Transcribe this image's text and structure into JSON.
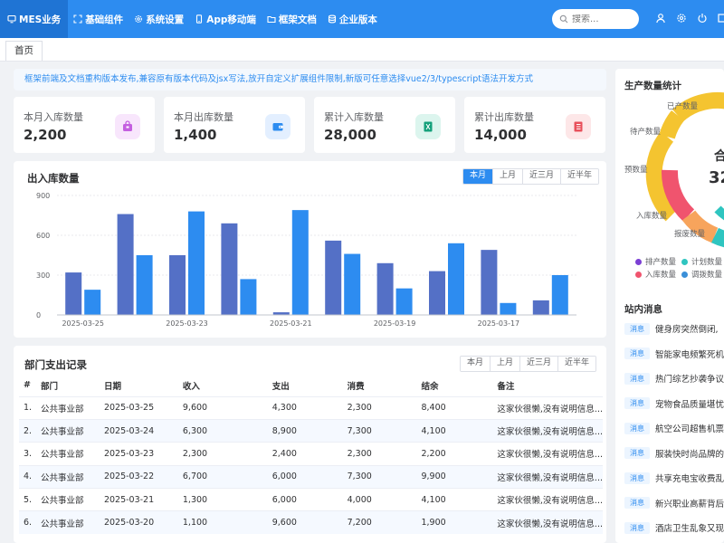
{
  "nav": {
    "items": [
      {
        "label": "MES业务",
        "icon": "monitor-icon"
      },
      {
        "label": "基础组件",
        "icon": "expand-icon"
      },
      {
        "label": "系统设置",
        "icon": "gear-icon"
      },
      {
        "label": "App移动端",
        "icon": "phone-icon"
      },
      {
        "label": "框架文档",
        "icon": "folder-icon"
      },
      {
        "label": "企业版本",
        "icon": "database-icon"
      }
    ],
    "search_placeholder": "搜索...",
    "icons": [
      "user-icon",
      "gear-icon",
      "power-icon",
      "window-icon"
    ]
  },
  "tabs": {
    "home": "首页"
  },
  "notice": "框架前端及文档重构版本发布,兼容原有版本代码及jsx写法,放开自定义扩展组件限制,新版可任意选择vue2/3/typescript语法开发方式",
  "stats": [
    {
      "label": "本月入库数量",
      "value": "2,200",
      "icon": "bag-icon",
      "color": "#c45fe0",
      "bg": "#f8e6fc"
    },
    {
      "label": "本月出库数量",
      "value": "1,400",
      "icon": "wallet-icon",
      "color": "#2d8cf0",
      "bg": "#e3efff"
    },
    {
      "label": "累计入库数量",
      "value": "28,000",
      "icon": "book-icon",
      "color": "#13a07a",
      "bg": "#dcf5ee"
    },
    {
      "label": "累计出库数量",
      "value": "14,000",
      "icon": "notebook-icon",
      "color": "#e8505b",
      "bg": "#fde7e8"
    }
  ],
  "chart": {
    "title": "出入库数量",
    "filters": [
      "本月",
      "上月",
      "近三月",
      "近半年"
    ],
    "active_filter": 0
  },
  "chart_data": {
    "type": "bar",
    "categories": [
      "2025-03-25",
      "",
      "2025-03-23",
      "",
      "2025-03-21",
      "",
      "2025-03-19",
      "",
      "2025-03-17",
      ""
    ],
    "x_tick_labels": [
      "2025-03-25",
      "2025-03-23",
      "2025-03-21",
      "2025-03-19",
      "2025-03-17"
    ],
    "series": [
      {
        "color": "#5470c6",
        "values": [
          320,
          760,
          450,
          690,
          20,
          560,
          390,
          330,
          490,
          110
        ]
      },
      {
        "color": "#2d8cf0",
        "values": [
          190,
          450,
          780,
          270,
          790,
          460,
          200,
          540,
          90,
          300
        ]
      }
    ],
    "ylim": [
      0,
      900
    ],
    "yticks": [
      "0",
      "300",
      "600",
      "900"
    ],
    "grid": true
  },
  "table": {
    "title": "部门支出记录",
    "filters": [
      "本月",
      "上月",
      "近三月",
      "近半年"
    ],
    "columns": [
      "#",
      "部门",
      "日期",
      "收入",
      "支出",
      "消费",
      "结余",
      "备注"
    ],
    "rows": [
      [
        "1.",
        "公共事业部",
        "2025-03-25",
        "9,600",
        "4,300",
        "2,300",
        "8,400",
        "这家伙很懒,没有说明信息..."
      ],
      [
        "2.",
        "公共事业部",
        "2025-03-24",
        "6,300",
        "8,900",
        "7,300",
        "4,100",
        "这家伙很懒,没有说明信息..."
      ],
      [
        "3.",
        "公共事业部",
        "2025-03-23",
        "2,300",
        "2,400",
        "2,300",
        "2,200",
        "这家伙很懒,没有说明信息..."
      ],
      [
        "4.",
        "公共事业部",
        "2025-03-22",
        "6,700",
        "6,000",
        "7,300",
        "9,900",
        "这家伙很懒,没有说明信息..."
      ],
      [
        "5.",
        "公共事业部",
        "2025-03-21",
        "1,300",
        "6,000",
        "4,000",
        "4,100",
        "这家伙很懒,没有说明信息..."
      ],
      [
        "6.",
        "公共事业部",
        "2025-03-20",
        "1,100",
        "9,600",
        "7,200",
        "1,900",
        "这家伙很懒,没有说明信息..."
      ]
    ]
  },
  "production": {
    "title": "生产数量统计",
    "center_text": "合",
    "center_value": "32",
    "labels": [
      "已产数量",
      "待产数量",
      "预数量",
      "入库数量",
      "报废数量"
    ],
    "legend": [
      {
        "label": "排产数量",
        "color": "#7b3fd4"
      },
      {
        "label": "计划数量",
        "color": "#2fc5c0"
      },
      {
        "label": "入库数量",
        "color": "#f0546e"
      },
      {
        "label": "调拨数量",
        "color": "#3a8fd8"
      }
    ],
    "donut_colors": [
      "#f4c430",
      "#2fc5c0",
      "#f0546e",
      "#3a8fd8",
      "#f7a45c"
    ]
  },
  "messages": {
    "title": "站内消息",
    "badge": "消息",
    "items": [
      "健身房突然倒闭,",
      "智能家电频繁死机",
      "热门综艺抄袭争议",
      "宠物食品质量堪忧",
      "航空公司超售机票",
      "服装快时尚品牌的",
      "共享充电宝收费乱",
      "新兴职业高薪背后",
      "酒店卫生乱象又现"
    ]
  }
}
